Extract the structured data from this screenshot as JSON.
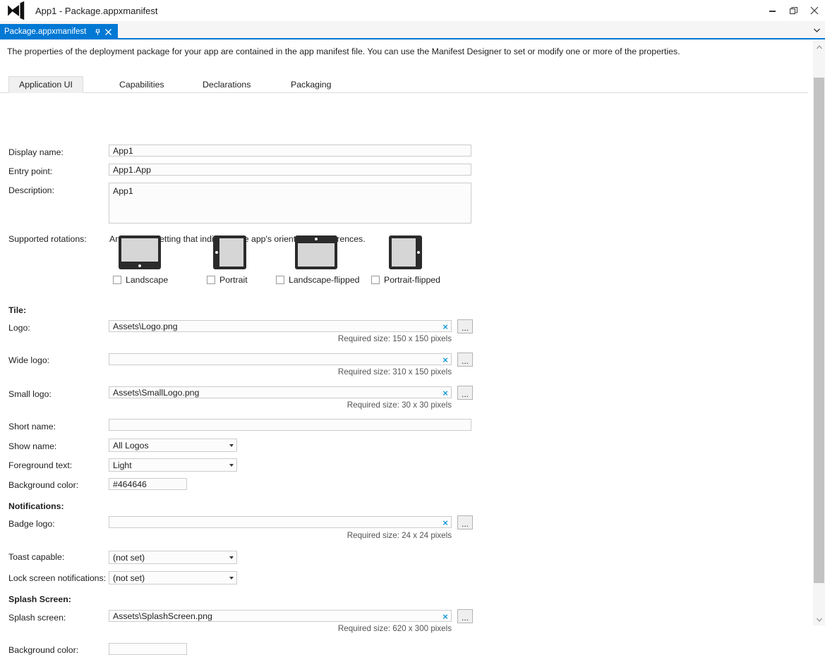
{
  "titlebar": {
    "logo_icon": "visual-studio-logo",
    "title": "App1 - Package.appxmanifest",
    "minimize_label": "Minimize",
    "restore_label": "Restore",
    "close_label": "Close"
  },
  "tabstrip": {
    "doc_tab_label": "Package.appxmanifest",
    "pin_icon": "pin-icon",
    "close_icon": "close-icon",
    "chevron_icon": "chevron-down-icon"
  },
  "content": {
    "intro": "The properties of the deployment package for your app are contained in the app manifest file. You can use the Manifest Designer to set or modify one or more of the properties."
  },
  "designer_tabs": [
    {
      "label": "Application UI",
      "selected": true
    },
    {
      "label": "Capabilities",
      "selected": false
    },
    {
      "label": "Declarations",
      "selected": false
    },
    {
      "label": "Packaging",
      "selected": false
    }
  ],
  "fields": {
    "display_name": {
      "label": "Display name:",
      "value": "App1"
    },
    "entry_point": {
      "label": "Entry point:",
      "value": "App1.App"
    },
    "description": {
      "label": "Description:",
      "value": "App1"
    },
    "supported_rotations": {
      "label": "Supported rotations:",
      "description": "An optional setting that indicates the app's orientation preferences.",
      "options": [
        {
          "label": "Landscape",
          "icon": "tablet-landscape-icon",
          "checked": false
        },
        {
          "label": "Portrait",
          "icon": "tablet-portrait-icon",
          "checked": false
        },
        {
          "label": "Landscape-flipped",
          "icon": "tablet-landscape-flipped-icon",
          "checked": false
        },
        {
          "label": "Portrait-flipped",
          "icon": "tablet-portrait-flipped-icon",
          "checked": false
        }
      ]
    }
  },
  "sections": {
    "tile": {
      "heading": "Tile:",
      "logo": {
        "label": "Logo:",
        "value": "Assets\\Logo.png",
        "hint": "Required size: 150 x 150 pixels",
        "clear_icon": "clear-x-icon",
        "browse_label": "..."
      },
      "wide_logo": {
        "label": "Wide logo:",
        "value": "",
        "hint": "Required size: 310 x 150 pixels",
        "clear_icon": "clear-x-icon",
        "browse_label": "..."
      },
      "small_logo": {
        "label": "Small logo:",
        "value": "Assets\\SmallLogo.png",
        "hint": "Required size: 30 x 30 pixels",
        "clear_icon": "clear-x-icon",
        "browse_label": "..."
      },
      "short_name": {
        "label": "Short name:",
        "value": ""
      },
      "show_name": {
        "label": "Show name:",
        "value": "All Logos"
      },
      "foreground_text": {
        "label": "Foreground text:",
        "value": "Light"
      },
      "background_color": {
        "label": "Background color:",
        "value": "#464646"
      }
    },
    "notifications": {
      "heading": "Notifications:",
      "badge_logo": {
        "label": "Badge logo:",
        "value": "",
        "hint": "Required size: 24 x 24 pixels",
        "clear_icon": "clear-x-icon",
        "browse_label": "..."
      },
      "toast_capable": {
        "label": "Toast capable:",
        "value": "(not set)"
      },
      "lock_screen_notifications": {
        "label": "Lock screen notifications:",
        "value": "(not set)"
      }
    },
    "splash_screen": {
      "heading": "Splash Screen:",
      "splash": {
        "label": "Splash screen:",
        "value": "Assets\\SplashScreen.png",
        "hint": "Required size: 620 x 300 pixels",
        "clear_icon": "clear-x-icon",
        "browse_label": "..."
      },
      "background_color": {
        "label": "Background color:",
        "value": ""
      }
    }
  },
  "scrollbar": {
    "up_icon": "scroll-up-arrow-icon",
    "down_icon": "scroll-down-arrow-icon",
    "thumb": "scroll-thumb"
  },
  "colors": {
    "accent": "#0078d4",
    "clear_x": "#1a9ad7",
    "tile_background": "#464646"
  }
}
